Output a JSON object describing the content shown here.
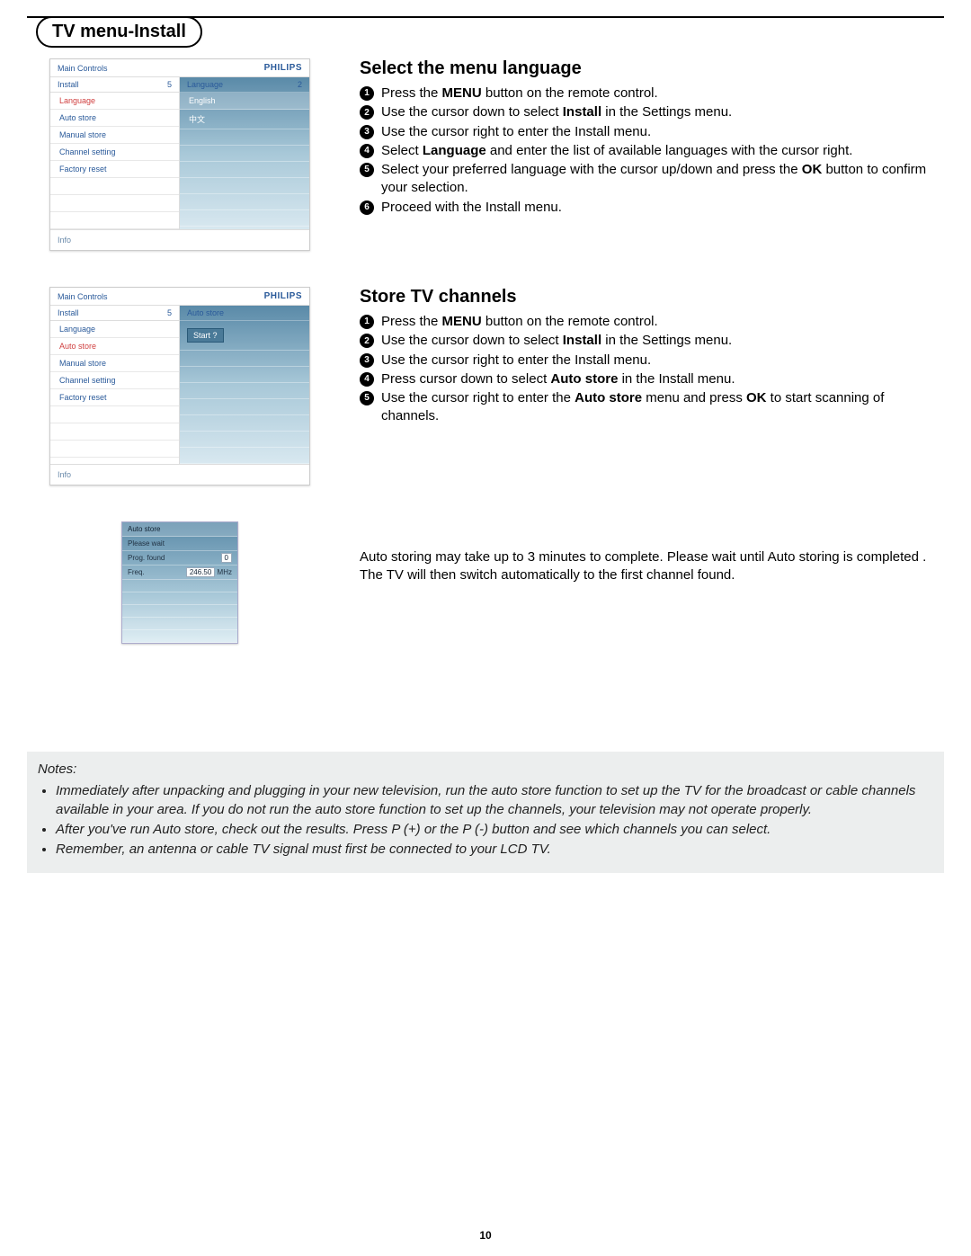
{
  "page_title": "TV menu-Install",
  "page_number": "10",
  "section1": {
    "heading": "Select the menu language",
    "steps": [
      {
        "n": "1",
        "html": "Press the <b>MENU</b> button on the remote control."
      },
      {
        "n": "2",
        "html": "Use the cursor down to select <b>Install</b> in the Settings menu."
      },
      {
        "n": "3",
        "html": "Use the cursor right to enter the Install menu."
      },
      {
        "n": "4",
        "html": "Select <b>Language</b> and enter the list of available languages with the cursor right."
      },
      {
        "n": "5",
        "html": "Select your preferred language with the cursor up/down and press the <b>OK</b> button to confirm your selection."
      },
      {
        "n": "6",
        "html": "Proceed with the Install menu."
      }
    ]
  },
  "section2": {
    "heading": "Store TV channels",
    "steps": [
      {
        "n": "1",
        "html": "Press the <b>MENU</b> button on the remote control."
      },
      {
        "n": "2",
        "html": "Use the cursor down to select <b>Install</b> in the Settings menu."
      },
      {
        "n": "3",
        "html": "Use the cursor right to enter the Install menu."
      },
      {
        "n": "4",
        "html": "Press cursor down to select <b>Auto store</b> in the Install menu."
      },
      {
        "n": "5",
        "html": "Use the cursor right to enter the <b>Auto store</b> menu and press <b>OK</b> to start scanning of channels."
      }
    ]
  },
  "section3_note": "Auto storing may take up to 3 minutes to complete.  Please wait until Auto storing is completed .  The TV will then switch automatically to the first channel found.",
  "menu1": {
    "main_controls": "Main Controls",
    "brand": "PHILIPS",
    "left_header": "Install",
    "left_count": "5",
    "right_header": "Language",
    "right_count": "2",
    "left_items": [
      "Language",
      "Auto store",
      "Manual store",
      "Channel setting",
      "Factory reset"
    ],
    "active_left_index": 0,
    "right_items": [
      "English",
      "中文"
    ],
    "footer": "Info"
  },
  "menu2": {
    "main_controls": "Main Controls",
    "brand": "PHILIPS",
    "left_header": "Install",
    "left_count": "5",
    "right_header": "Auto store",
    "right_count": "",
    "left_items": [
      "Language",
      "Auto store",
      "Manual store",
      "Channel setting",
      "Factory reset"
    ],
    "active_left_index": 1,
    "start_label": "Start ?",
    "footer": "Info"
  },
  "progress_panel": {
    "title": "Auto store",
    "rows": [
      {
        "label": "Please wait",
        "value": ""
      },
      {
        "label": "Prog. found",
        "value": "0"
      },
      {
        "label": "Freq.",
        "value": "246.50",
        "suffix": "MHz"
      }
    ]
  },
  "notes": {
    "title": "Notes:",
    "items": [
      "Immediately after unpacking and plugging in your new television, run the auto store function to set up the TV for the broadcast or cable channels available in your area.  If you do not run the auto store function to set up the channels, your television may not operate properly.",
      "After you've run Auto store, check out the results.  Press P (+) or the P (-) button and see which channels you can select.",
      "Remember, an antenna or cable TV signal must first be connected to your LCD TV."
    ]
  }
}
